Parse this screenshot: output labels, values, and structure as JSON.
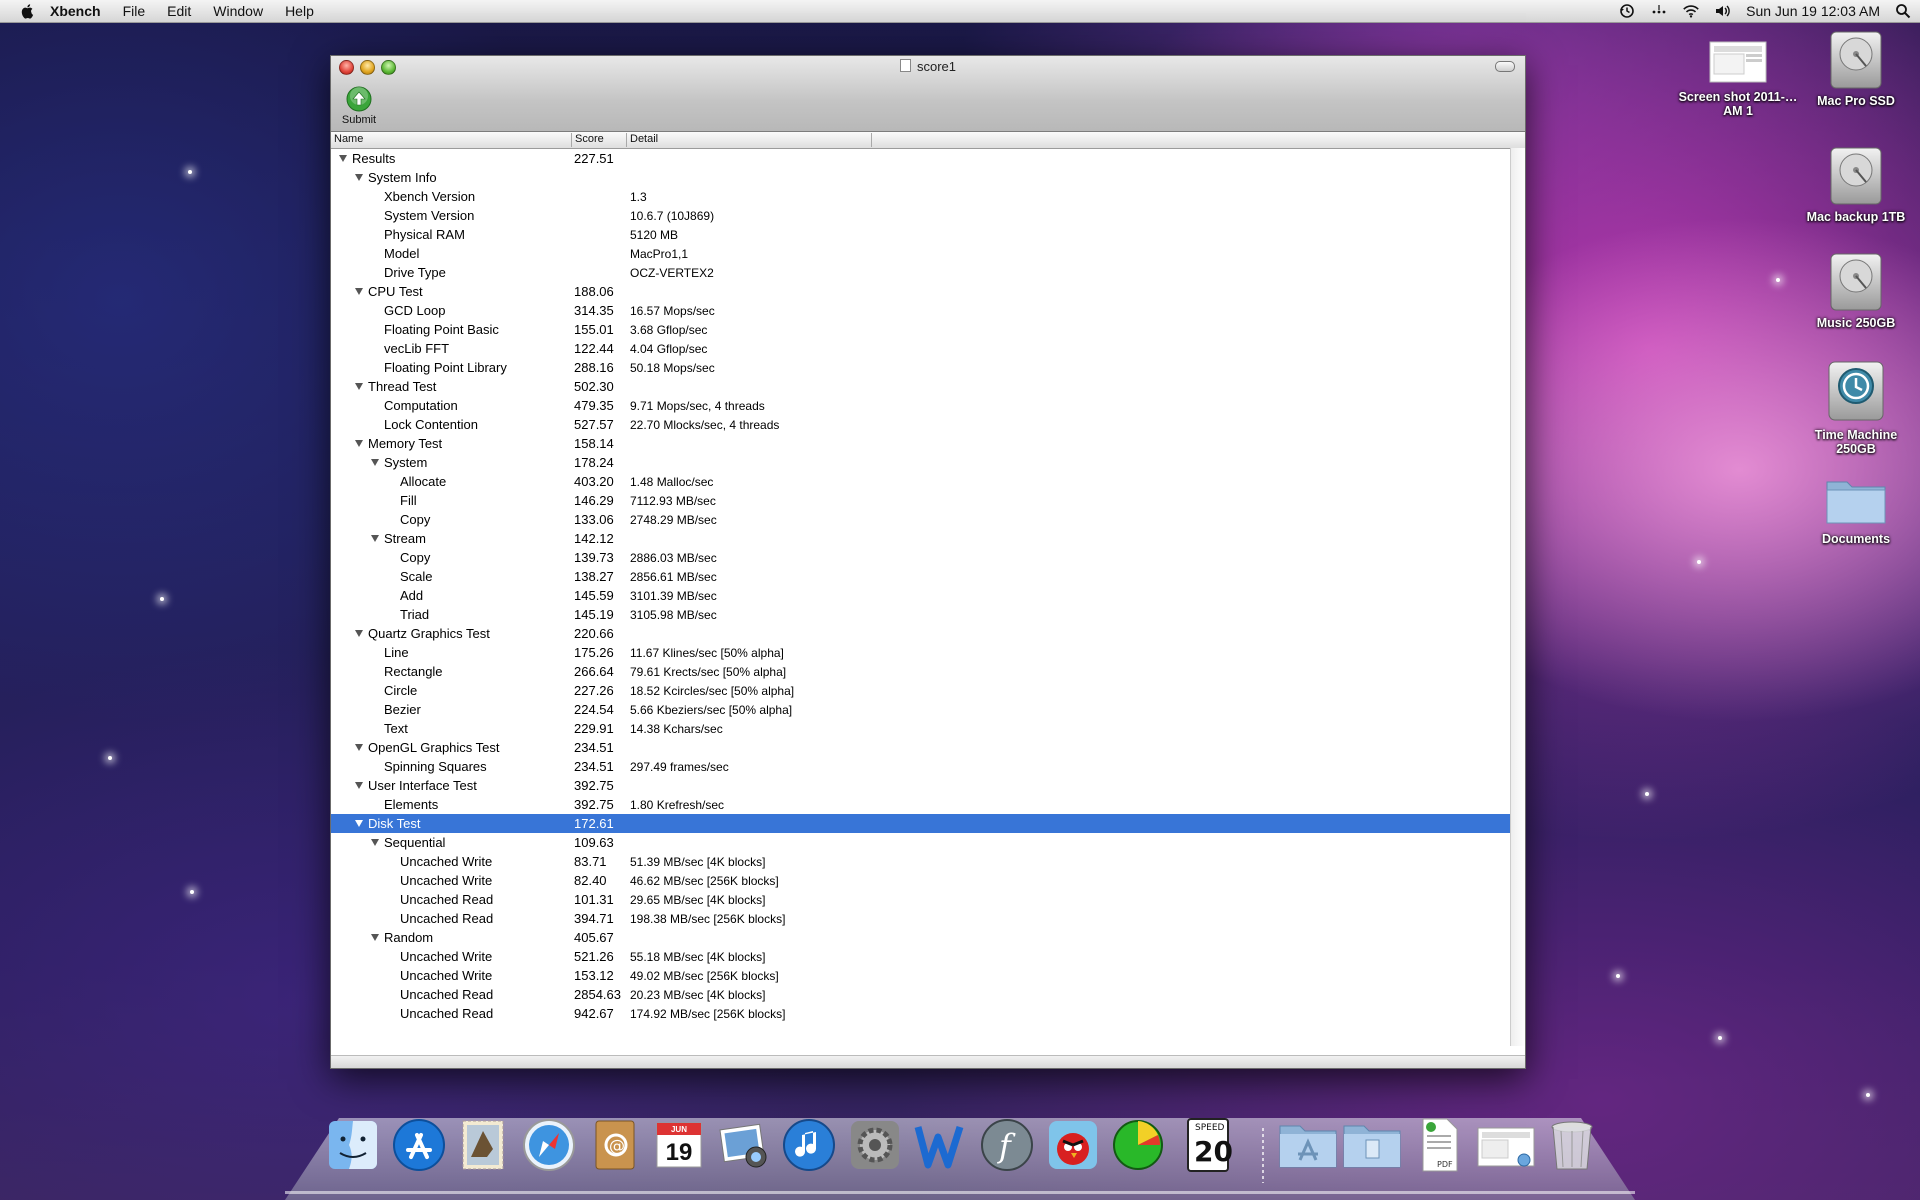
{
  "menubar": {
    "app_name": "Xbench",
    "menus": [
      "File",
      "Edit",
      "Window",
      "Help"
    ],
    "clock": "Sun Jun 19  12:03 AM"
  },
  "desktop_icons": [
    {
      "label": "Screen shot 2011-… AM 1",
      "icon": "screenshot-file-icon"
    },
    {
      "label": "Mac Pro SSD",
      "icon": "hard-drive-icon"
    },
    {
      "label": "Mac backup 1TB",
      "icon": "hard-drive-icon"
    },
    {
      "label": "Music 250GB",
      "icon": "hard-drive-icon"
    },
    {
      "label": "Time Machine 250GB",
      "icon": "time-machine-drive-icon"
    },
    {
      "label": "Documents",
      "icon": "folder-icon"
    }
  ],
  "window": {
    "title": "score1",
    "toolbar": {
      "submit_label": "Submit"
    },
    "columns": {
      "name": "Name",
      "score": "Score",
      "detail": "Detail"
    },
    "rows": [
      {
        "name": "Results",
        "score": "227.51",
        "detail": "",
        "level": 0,
        "expanded": true
      },
      {
        "name": "System Info",
        "score": "",
        "detail": "",
        "level": 1,
        "expanded": true
      },
      {
        "name": "Xbench Version",
        "score": "",
        "detail": "1.3",
        "level": 2
      },
      {
        "name": "System Version",
        "score": "",
        "detail": "10.6.7 (10J869)",
        "level": 2
      },
      {
        "name": "Physical RAM",
        "score": "",
        "detail": "5120 MB",
        "level": 2
      },
      {
        "name": "Model",
        "score": "",
        "detail": "MacPro1,1",
        "level": 2
      },
      {
        "name": "Drive Type",
        "score": "",
        "detail": "OCZ-VERTEX2",
        "level": 2
      },
      {
        "name": "CPU Test",
        "score": "188.06",
        "detail": "",
        "level": 1,
        "expanded": true
      },
      {
        "name": "GCD Loop",
        "score": "314.35",
        "detail": "16.57 Mops/sec",
        "level": 2
      },
      {
        "name": "Floating Point Basic",
        "score": "155.01",
        "detail": "3.68 Gflop/sec",
        "level": 2
      },
      {
        "name": "vecLib FFT",
        "score": "122.44",
        "detail": "4.04 Gflop/sec",
        "level": 2
      },
      {
        "name": "Floating Point Library",
        "score": "288.16",
        "detail": "50.18 Mops/sec",
        "level": 2
      },
      {
        "name": "Thread Test",
        "score": "502.30",
        "detail": "",
        "level": 1,
        "expanded": true
      },
      {
        "name": "Computation",
        "score": "479.35",
        "detail": "9.71 Mops/sec, 4 threads",
        "level": 2
      },
      {
        "name": "Lock Contention",
        "score": "527.57",
        "detail": "22.70 Mlocks/sec, 4 threads",
        "level": 2
      },
      {
        "name": "Memory Test",
        "score": "158.14",
        "detail": "",
        "level": 1,
        "expanded": true
      },
      {
        "name": "System",
        "score": "178.24",
        "detail": "",
        "level": 2,
        "expanded": true
      },
      {
        "name": "Allocate",
        "score": "403.20",
        "detail": "1.48 Malloc/sec",
        "level": 3
      },
      {
        "name": "Fill",
        "score": "146.29",
        "detail": "7112.93 MB/sec",
        "level": 3
      },
      {
        "name": "Copy",
        "score": "133.06",
        "detail": "2748.29 MB/sec",
        "level": 3
      },
      {
        "name": "Stream",
        "score": "142.12",
        "detail": "",
        "level": 2,
        "expanded": true
      },
      {
        "name": "Copy",
        "score": "139.73",
        "detail": "2886.03 MB/sec",
        "level": 3
      },
      {
        "name": "Scale",
        "score": "138.27",
        "detail": "2856.61 MB/sec",
        "level": 3
      },
      {
        "name": "Add",
        "score": "145.59",
        "detail": "3101.39 MB/sec",
        "level": 3
      },
      {
        "name": "Triad",
        "score": "145.19",
        "detail": "3105.98 MB/sec",
        "level": 3
      },
      {
        "name": "Quartz Graphics Test",
        "score": "220.66",
        "detail": "",
        "level": 1,
        "expanded": true
      },
      {
        "name": "Line",
        "score": "175.26",
        "detail": "11.67 Klines/sec [50% alpha]",
        "level": 2
      },
      {
        "name": "Rectangle",
        "score": "266.64",
        "detail": "79.61 Krects/sec [50% alpha]",
        "level": 2
      },
      {
        "name": "Circle",
        "score": "227.26",
        "detail": "18.52 Kcircles/sec [50% alpha]",
        "level": 2
      },
      {
        "name": "Bezier",
        "score": "224.54",
        "detail": "5.66 Kbeziers/sec [50% alpha]",
        "level": 2
      },
      {
        "name": "Text",
        "score": "229.91",
        "detail": "14.38 Kchars/sec",
        "level": 2
      },
      {
        "name": "OpenGL Graphics Test",
        "score": "234.51",
        "detail": "",
        "level": 1,
        "expanded": true
      },
      {
        "name": "Spinning Squares",
        "score": "234.51",
        "detail": "297.49 frames/sec",
        "level": 2
      },
      {
        "name": "User Interface Test",
        "score": "392.75",
        "detail": "",
        "level": 1,
        "expanded": true
      },
      {
        "name": "Elements",
        "score": "392.75",
        "detail": "1.80 Krefresh/sec",
        "level": 2
      },
      {
        "name": "Disk Test",
        "score": "172.61",
        "detail": "",
        "level": 1,
        "expanded": true,
        "selected": true
      },
      {
        "name": "Sequential",
        "score": "109.63",
        "detail": "",
        "level": 2,
        "expanded": true
      },
      {
        "name": "Uncached Write",
        "score": "83.71",
        "detail": "51.39 MB/sec [4K blocks]",
        "level": 3
      },
      {
        "name": "Uncached Write",
        "score": "82.40",
        "detail": "46.62 MB/sec [256K blocks]",
        "level": 3
      },
      {
        "name": "Uncached Read",
        "score": "101.31",
        "detail": "29.65 MB/sec [4K blocks]",
        "level": 3
      },
      {
        "name": "Uncached Read",
        "score": "394.71",
        "detail": "198.38 MB/sec [256K blocks]",
        "level": 3
      },
      {
        "name": "Random",
        "score": "405.67",
        "detail": "",
        "level": 2,
        "expanded": true
      },
      {
        "name": "Uncached Write",
        "score": "521.26",
        "detail": "55.18 MB/sec [4K blocks]",
        "level": 3
      },
      {
        "name": "Uncached Write",
        "score": "153.12",
        "detail": "49.02 MB/sec [256K blocks]",
        "level": 3
      },
      {
        "name": "Uncached Read",
        "score": "2854.63",
        "detail": "20.23 MB/sec [4K blocks]",
        "level": 3
      },
      {
        "name": "Uncached Read",
        "score": "942.67",
        "detail": "174.92 MB/sec [256K blocks]",
        "level": 3
      }
    ]
  },
  "dock": {
    "items": [
      {
        "name": "Finder",
        "icon": "finder-icon"
      },
      {
        "name": "App Store",
        "icon": "app-store-icon"
      },
      {
        "name": "Mail",
        "icon": "mail-stamp-icon"
      },
      {
        "name": "Safari",
        "icon": "safari-compass-icon"
      },
      {
        "name": "Address Book",
        "icon": "address-book-icon"
      },
      {
        "name": "iCal",
        "icon": "calendar-icon",
        "text": "19",
        "subtext": "JUN"
      },
      {
        "name": "iPhoto",
        "icon": "photos-icon"
      },
      {
        "name": "iTunes",
        "icon": "itunes-icon"
      },
      {
        "name": "System Preferences",
        "icon": "gear-icon"
      },
      {
        "name": "Word",
        "icon": "word-icon",
        "text": "W"
      },
      {
        "name": "Font app",
        "icon": "font-icon",
        "text": "f"
      },
      {
        "name": "Angry Birds",
        "icon": "angry-bird-icon"
      },
      {
        "name": "iStat",
        "icon": "pie-chart-icon"
      },
      {
        "name": "Speed limit",
        "icon": "speed-sign-icon",
        "text": "20",
        "subtext": "SPEED"
      },
      {
        "name": "Applications",
        "icon": "applications-folder-icon"
      },
      {
        "name": "Documents",
        "icon": "documents-folder-icon"
      },
      {
        "name": "PDF",
        "icon": "pdf-document-icon",
        "subtext": "PDF"
      },
      {
        "name": "Screenshot",
        "icon": "screenshot-preview-icon"
      },
      {
        "name": "Trash",
        "icon": "trash-icon"
      }
    ]
  }
}
